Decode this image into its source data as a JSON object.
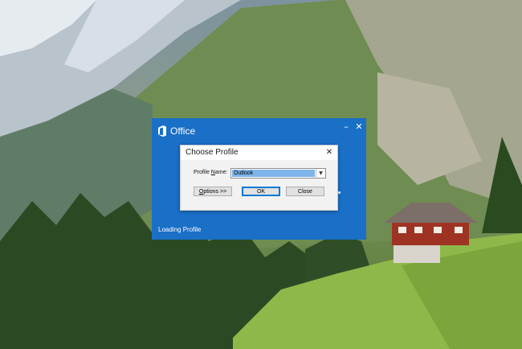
{
  "splash": {
    "brand_name": "Office",
    "minimize_glyph": "–",
    "close_glyph": "✕",
    "status_text": "Loading Profile",
    "brand_color": "#1a6fc7"
  },
  "dialog": {
    "title": "Choose Profile",
    "close_glyph": "✕",
    "profile_label_before": "Profile ",
    "profile_label_access": "N",
    "profile_label_after": "ame:",
    "profile_value": "Outlook",
    "options_access": "O",
    "options_rest": "ptions >>",
    "ok_label": "OK",
    "close_label": "Close",
    "selection_color": "#7eb4ea"
  },
  "icons": {
    "brand": "office-logo-icon",
    "dropdown": "chevron-down-icon"
  }
}
